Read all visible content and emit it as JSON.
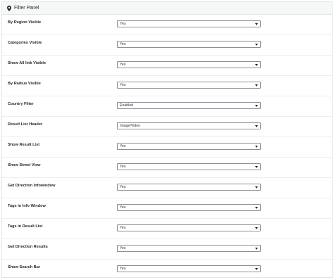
{
  "panel": {
    "title": "Filter Panel",
    "icon": "map-pin-icon"
  },
  "rows": [
    {
      "label": "By Region Visible",
      "value": "Yes"
    },
    {
      "label": "Categories Visible",
      "value": "Yes"
    },
    {
      "label": "Show All link Visible",
      "value": "Yes"
    },
    {
      "label": "By Radius Visible",
      "value": "Yes"
    },
    {
      "label": "Country Filter",
      "value": "Enabled"
    },
    {
      "label": "Result List Header",
      "value": "Image/Video"
    },
    {
      "label": "Show Result List",
      "value": "Yes"
    },
    {
      "label": "Show Street View",
      "value": "Yes"
    },
    {
      "label": "Get Direction Infowindow",
      "value": "Yes"
    },
    {
      "label": "Tags in Info Window",
      "value": "Yes"
    },
    {
      "label": "Tags in Result List",
      "value": "Yes"
    },
    {
      "label": "Get Direction Results",
      "value": "Yes"
    },
    {
      "label": "Show Search Bar",
      "value": "Yes"
    }
  ]
}
